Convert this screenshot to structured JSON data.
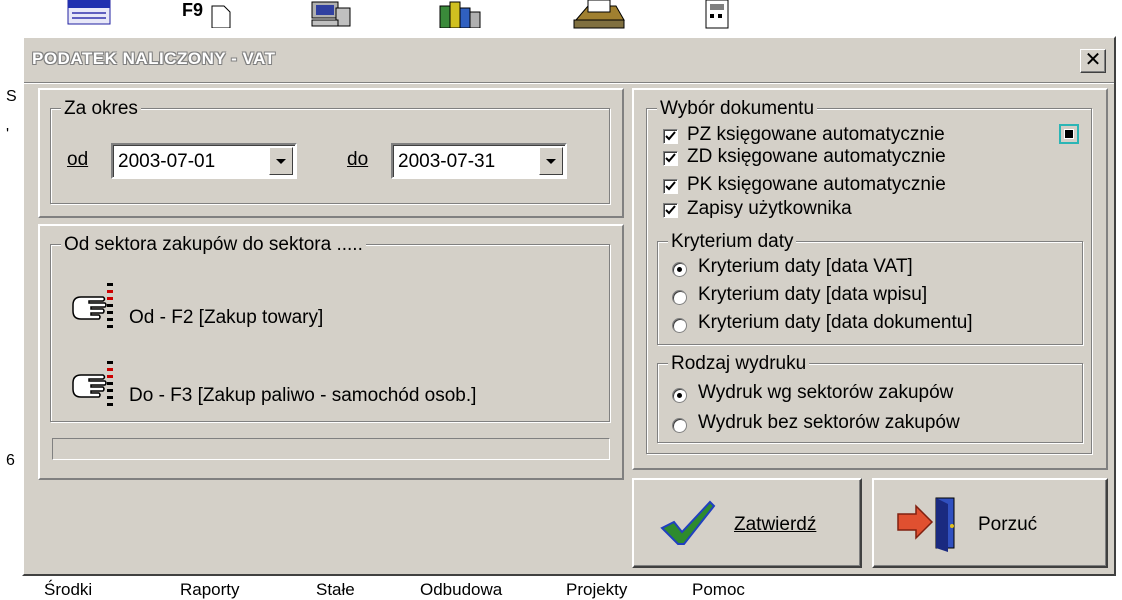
{
  "dialog": {
    "title": "PODATEK NALICZONY - VAT",
    "close_glyph": "✕"
  },
  "period": {
    "legend": "Za okres",
    "from_label": "od",
    "from_value": "2003-07-01",
    "to_label": "do",
    "to_value": "2003-07-31"
  },
  "sectors": {
    "legend": "Od sektora zakupów do sektora .....",
    "from_text": "Od - F2 [Zakup towary]",
    "to_text": "Do - F3 [Zakup paliwo - samochód osob.]"
  },
  "documents": {
    "legend": "Wybór dokumentu",
    "items": [
      {
        "label": "PZ księgowane automatycznie",
        "checked": true
      },
      {
        "label": "ZD księgowane automatycznie",
        "checked": true
      },
      {
        "label": "PK księgowane automatycznie",
        "checked": true
      },
      {
        "label": "Zapisy  użytkownika",
        "checked": true
      }
    ]
  },
  "date_criteria": {
    "legend": "Kryterium daty",
    "options": [
      {
        "label": "Kryterium daty  [data VAT]",
        "selected": true
      },
      {
        "label": "Kryterium daty  [data wpisu]",
        "selected": false
      },
      {
        "label": "Kryterium daty  [data dokumentu]",
        "selected": false
      }
    ]
  },
  "print_type": {
    "legend": "Rodzaj wydruku",
    "options": [
      {
        "label": "Wydruk wg  sektorów zakupów",
        "selected": true
      },
      {
        "label": "Wydruk bez sektorów zakupów",
        "selected": false
      }
    ]
  },
  "buttons": {
    "confirm": "Zatwierdź",
    "cancel": "Porzuć"
  },
  "background": {
    "left_chars": [
      "S",
      "'",
      "6"
    ],
    "menu": [
      "Środki",
      "Raporty",
      "Stałe",
      "Odbudowa",
      "Projekty",
      "Pomoc"
    ],
    "toolbar_key": "F9"
  }
}
